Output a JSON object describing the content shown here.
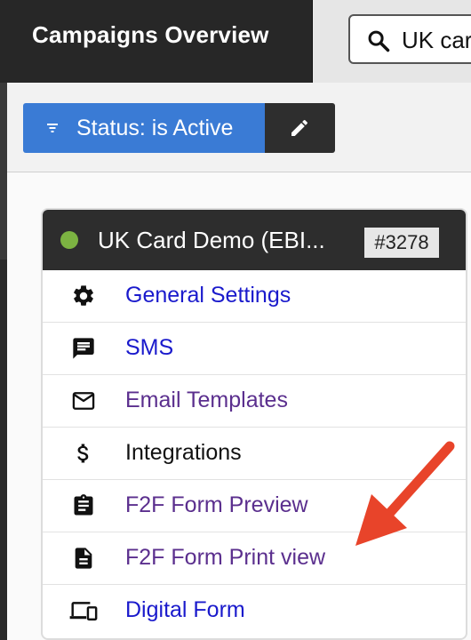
{
  "header": {
    "title": "Campaigns Overview",
    "search": {
      "value": "UK card",
      "icon": "search-icon"
    }
  },
  "filter": {
    "label": "Status: is Active",
    "icon": "filter-list-icon",
    "edit_icon": "pencil-icon",
    "chip_color": "#3a7bd5"
  },
  "campaign": {
    "name": "UK Card Demo (EBI...",
    "id": "#3278",
    "status_color": "#7cb342",
    "menu": [
      {
        "label": "General Settings",
        "icon": "gear-icon",
        "color": "#1a1acc"
      },
      {
        "label": "SMS",
        "icon": "sms-icon",
        "color": "#1a1acc"
      },
      {
        "label": "Email Templates",
        "icon": "envelope-icon",
        "color": "#5b2f8e"
      },
      {
        "label": "Integrations",
        "icon": "dollar-icon",
        "color": "#111111"
      },
      {
        "label": "F2F Form Preview",
        "icon": "clipboard-icon",
        "color": "#5b2f8e"
      },
      {
        "label": "F2F Form Print view",
        "icon": "document-icon",
        "color": "#5b2f8e"
      },
      {
        "label": "Digital Form",
        "icon": "devices-icon",
        "color": "#1a1acc"
      }
    ]
  },
  "annotation": {
    "arrow_color": "#e8442a"
  }
}
